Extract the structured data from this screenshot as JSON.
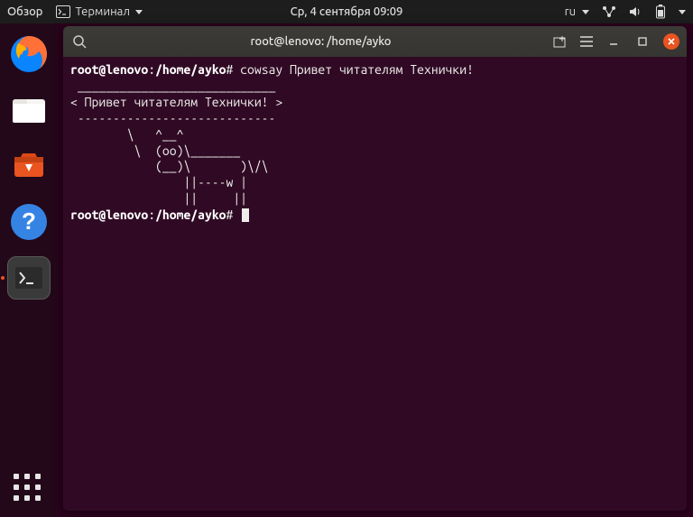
{
  "top_panel": {
    "activities": "Обзор",
    "app_name": "Терминал",
    "datetime": "Ср, 4 сентября  09:09",
    "lang": "ru"
  },
  "dock": {
    "items": [
      {
        "name": "firefox"
      },
      {
        "name": "files"
      },
      {
        "name": "software"
      },
      {
        "name": "help"
      },
      {
        "name": "terminal",
        "running": true
      }
    ]
  },
  "terminal": {
    "title": "root@lenovo: /home/ayko",
    "prompt1_user": "root@lenovo",
    "prompt1_path": "/home/ayko",
    "prompt1_symbol": "#",
    "command1": "cowsay Привет читателям Технички!",
    "output_lines": [
      " ____________________________ ",
      "< Привет читателям Технички! >",
      " ---------------------------- ",
      "        \\   ^__^",
      "         \\  (oo)\\_______",
      "            (__)\\       )\\/\\",
      "                ||----w |",
      "                ||     ||"
    ],
    "prompt2_user": "root@lenovo",
    "prompt2_path": "/home/ayko",
    "prompt2_symbol": "#"
  }
}
